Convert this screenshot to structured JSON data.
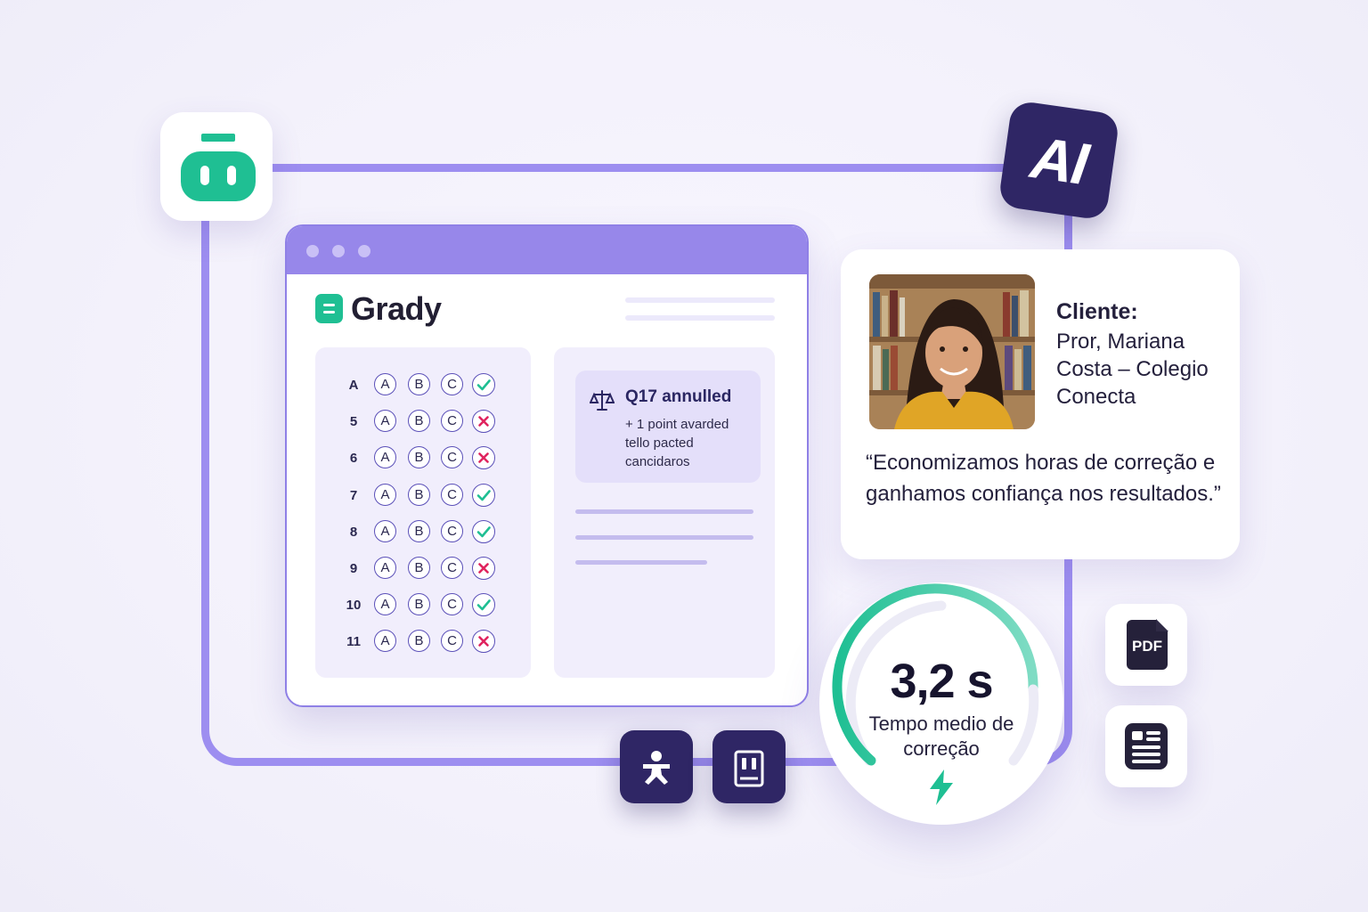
{
  "brand": {
    "name": "Grady"
  },
  "badges": {
    "ai_label": "AI"
  },
  "answer_sheet": {
    "rows": [
      {
        "q": "A",
        "options": [
          "A",
          "B",
          "C"
        ],
        "result": "correct"
      },
      {
        "q": "5",
        "options": [
          "A",
          "B",
          "C"
        ],
        "result": "wrong"
      },
      {
        "q": "6",
        "options": [
          "A",
          "B",
          "C"
        ],
        "result": "wrong"
      },
      {
        "q": "7",
        "options": [
          "A",
          "B",
          "C"
        ],
        "result": "correct"
      },
      {
        "q": "8",
        "options": [
          "A",
          "B",
          "C"
        ],
        "result": "correct"
      },
      {
        "q": "9",
        "options": [
          "A",
          "B",
          "C"
        ],
        "result": "wrong"
      },
      {
        "q": "10",
        "options": [
          "A",
          "B",
          "C"
        ],
        "result": "correct"
      },
      {
        "q": "11",
        "options": [
          "A",
          "B",
          "C"
        ],
        "result": "wrong"
      }
    ]
  },
  "notice": {
    "title": "Q17 annulled",
    "body": "+ 1 point avarded tello pacted cancidaros"
  },
  "testimonial": {
    "client_label": "Cliente:",
    "client_name": "Pror, Mariana Costa – Colegio Conecta",
    "quote": "“Economizamos horas de correção e ganhamos confiança nos resultados.”"
  },
  "metric": {
    "value": "3,2 s",
    "label": "Tempo medio de correção"
  },
  "file_badges": {
    "pdf_label": "PDF"
  },
  "colors": {
    "accent_purple": "#9787ea",
    "dark_navy": "#2f2665",
    "brand_green": "#1fbf93",
    "correct": "#1fbf93",
    "wrong": "#e0245e"
  }
}
